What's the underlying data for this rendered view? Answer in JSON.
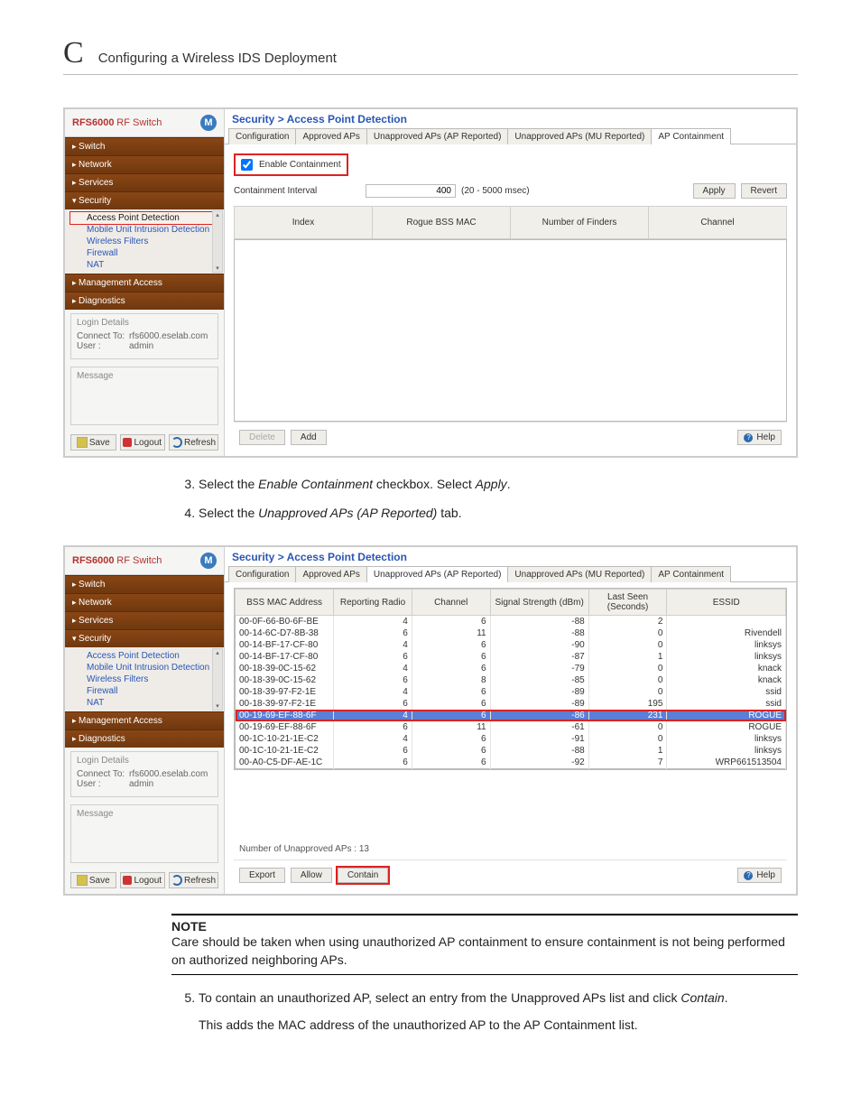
{
  "page": {
    "appendix_letter": "C",
    "appendix_title": "Configuring a Wireless IDS Deployment"
  },
  "side": {
    "brand_model": "RFS6000",
    "brand_sub": "RF Switch",
    "logo": "M",
    "nav": {
      "switch": "Switch",
      "network": "Network",
      "services": "Services",
      "security": "Security",
      "mgmt": "Management Access",
      "diag": "Diagnostics"
    },
    "tree": {
      "apd": "Access Point Detection",
      "muid": "Mobile Unit Intrusion Detection",
      "wf": "Wireless Filters",
      "fw": "Firewall",
      "nat": "NAT"
    },
    "login": {
      "title": "Login Details",
      "connect_lbl": "Connect To:",
      "connect_val": "rfs6000.eselab.com",
      "user_lbl": "User :",
      "user_val": "admin"
    },
    "msg_title": "Message",
    "btn": {
      "save": "Save",
      "logout": "Logout",
      "refresh": "Refresh"
    }
  },
  "shot1": {
    "crumb": "Security > Access Point Detection",
    "tabs": {
      "cfg": "Configuration",
      "appr": "Approved APs",
      "uap_ap": "Unapproved APs (AP Reported)",
      "uap_mu": "Unapproved APs (MU Reported)",
      "apc": "AP Containment"
    },
    "enable_lbl": "Enable Containment",
    "interval_lbl": "Containment Interval",
    "interval_val": "400",
    "interval_hint": "(20 - 5000 msec)",
    "btn_apply": "Apply",
    "btn_revert": "Revert",
    "cols": {
      "idx": "Index",
      "mac": "Rogue BSS MAC",
      "nf": "Number of Finders",
      "ch": "Channel"
    },
    "btn_delete": "Delete",
    "btn_add": "Add",
    "btn_help": "Help"
  },
  "shot2": {
    "crumb": "Security > Access Point Detection",
    "tabs": {
      "cfg": "Configuration",
      "appr": "Approved APs",
      "uap_ap": "Unapproved APs (AP Reported)",
      "uap_mu": "Unapproved APs (MU Reported)",
      "apc": "AP Containment"
    },
    "cols": {
      "mac": "BSS MAC Address",
      "radio": "Reporting Radio",
      "ch": "Channel",
      "ss": "Signal Strength (dBm)",
      "ls": "Last Seen (Seconds)",
      "essid": "ESSID"
    },
    "rows": [
      {
        "mac": "00-0F-66-B0-6F-BE",
        "radio": "4",
        "ch": "6",
        "ss": "-88",
        "ls": "2",
        "essid": ""
      },
      {
        "mac": "00-14-6C-D7-8B-38",
        "radio": "6",
        "ch": "11",
        "ss": "-88",
        "ls": "0",
        "essid": "Rivendell"
      },
      {
        "mac": "00-14-BF-17-CF-80",
        "radio": "4",
        "ch": "6",
        "ss": "-90",
        "ls": "0",
        "essid": "linksys"
      },
      {
        "mac": "00-14-BF-17-CF-80",
        "radio": "6",
        "ch": "6",
        "ss": "-87",
        "ls": "1",
        "essid": "linksys"
      },
      {
        "mac": "00-18-39-0C-15-62",
        "radio": "4",
        "ch": "6",
        "ss": "-79",
        "ls": "0",
        "essid": "knack"
      },
      {
        "mac": "00-18-39-0C-15-62",
        "radio": "6",
        "ch": "8",
        "ss": "-85",
        "ls": "0",
        "essid": "knack"
      },
      {
        "mac": "00-18-39-97-F2-1E",
        "radio": "4",
        "ch": "6",
        "ss": "-89",
        "ls": "0",
        "essid": "ssid"
      },
      {
        "mac": "00-18-39-97-F2-1E",
        "radio": "6",
        "ch": "6",
        "ss": "-89",
        "ls": "195",
        "essid": "ssid"
      },
      {
        "mac": "00-19-69-EF-88-6F",
        "radio": "4",
        "ch": "6",
        "ss": "-86",
        "ls": "231",
        "essid": "ROGUE"
      },
      {
        "mac": "00-19-69-EF-88-6F",
        "radio": "6",
        "ch": "11",
        "ss": "-61",
        "ls": "0",
        "essid": "ROGUE"
      },
      {
        "mac": "00-1C-10-21-1E-C2",
        "radio": "4",
        "ch": "6",
        "ss": "-91",
        "ls": "0",
        "essid": "linksys"
      },
      {
        "mac": "00-1C-10-21-1E-C2",
        "radio": "6",
        "ch": "6",
        "ss": "-88",
        "ls": "1",
        "essid": "linksys"
      },
      {
        "mac": "00-A0-C5-DF-AE-1C",
        "radio": "6",
        "ch": "6",
        "ss": "-92",
        "ls": "7",
        "essid": "WRP661513504"
      }
    ],
    "sel_index": 8,
    "count_lbl": "Number of Unapproved APs : 13",
    "btn_export": "Export",
    "btn_allow": "Allow",
    "btn_contain": "Contain",
    "btn_help": "Help"
  },
  "steps": {
    "s3": "Select the ",
    "s3_i": "Enable Containment",
    "s3b": " checkbox. Select ",
    "s3_i2": "Apply",
    "s4": "Select the ",
    "s4_i": "Unapproved APs (AP Reported)",
    "s4b": " tab.",
    "s5a": "To contain an unauthorized AP, select an entry from the Unapproved APs list and click ",
    "s5_i": "Contain",
    "s5c": "This adds the MAC address of the unauthorized AP to the AP Containment list."
  },
  "note": {
    "title": "NOTE",
    "text": "Care should be taken when using unauthorized AP containment to ensure  containment is not being performed on authorized neighboring APs."
  }
}
